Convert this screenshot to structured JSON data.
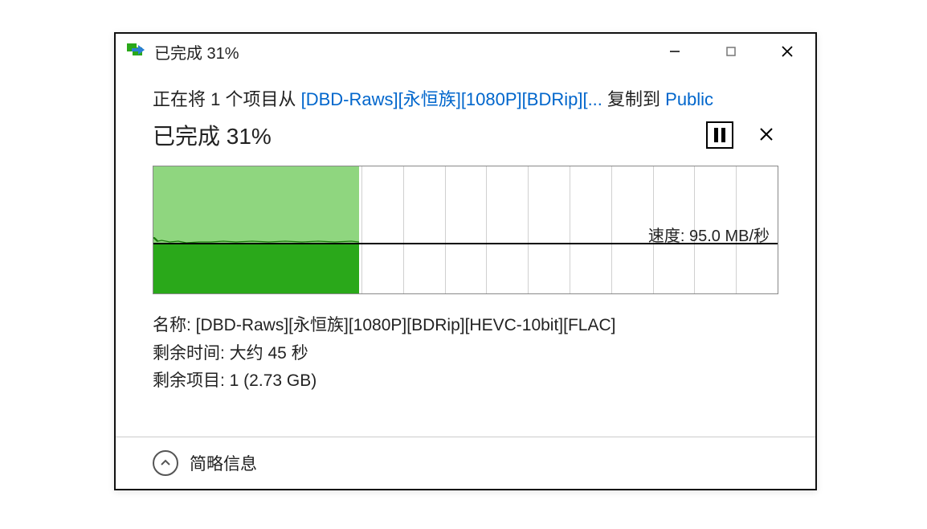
{
  "titlebar": {
    "title": "已完成 31%"
  },
  "copy_line": {
    "prefix": "正在将 1 个项目从 ",
    "source": "[DBD-Raws][永恒族][1080P][BDRip][...",
    "middle": " 复制到 ",
    "destination": "Public"
  },
  "status": {
    "text": "已完成 31%"
  },
  "chart_data": {
    "type": "area",
    "progress_percent": 31,
    "speed_label": "速度: 95.0 MB/秒",
    "grid_columns": 15,
    "fill_width_percent": 33,
    "midline_percent": 60
  },
  "details": {
    "name_label": "名称: ",
    "name_value": "[DBD-Raws][永恒族][1080P][BDRip][HEVC-10bit][FLAC]",
    "time_remaining_label": "剩余时间: ",
    "time_remaining_value": "大约 45 秒",
    "items_remaining_label": "剩余项目: ",
    "items_remaining_value": "1 (2.73 GB)"
  },
  "footer": {
    "label": "简略信息"
  }
}
